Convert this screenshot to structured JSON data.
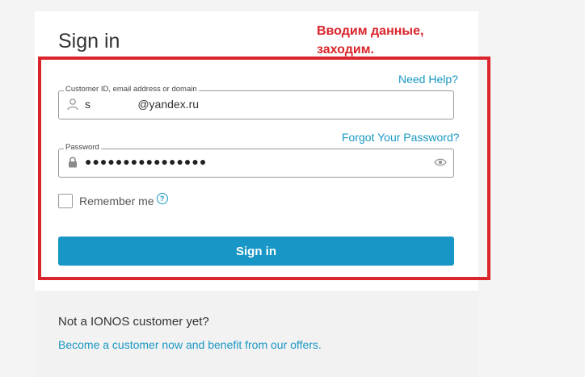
{
  "page": {
    "title": "Sign in",
    "annotation": "Вводим данные,\nзаходим."
  },
  "form": {
    "need_help": "Need Help?",
    "customer_id_label": "Customer ID, email address or domain",
    "customer_id_value": "s               @yandex.ru",
    "forgot_password": "Forgot Your Password?",
    "password_label": "Password",
    "password_mask": "●●●●●●●●●●●●●●●●",
    "remember_me": "Remember me",
    "help_glyph": "?",
    "sign_in_button": "Sign in"
  },
  "footer": {
    "not_customer": "Not a IONOS customer yet?",
    "become_customer": "Become a customer now and benefit from our offers."
  },
  "icons": {
    "user": "user-icon",
    "lock": "lock-icon",
    "eye": "eye-icon",
    "help": "question-icon"
  },
  "colors": {
    "accent": "#1896c6",
    "link": "#1a98c4",
    "annotation": "#d9252b"
  }
}
